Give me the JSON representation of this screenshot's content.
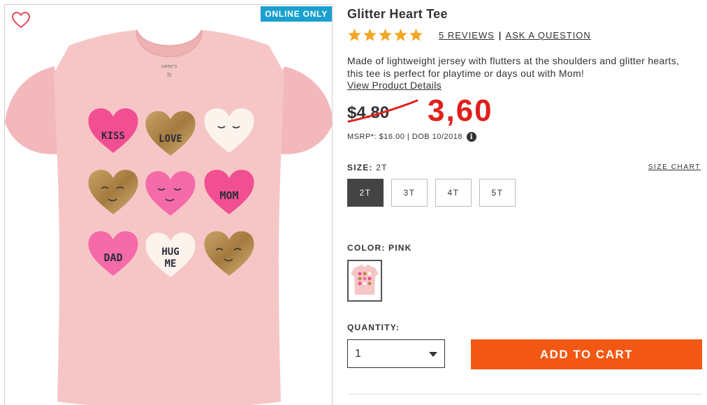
{
  "product": {
    "badge": "ONLINE ONLY",
    "title": "Glitter Heart Tee",
    "rating_stars": 5,
    "reviews_label": "5 REVIEWS",
    "separator": "|",
    "ask_label": "ASK A QUESTION",
    "description": "Made of lightweight jersey with flutters at the shoulders and glitter hearts, this tee is perfect for playtime or days out with Mom!",
    "details_link": "View Product Details",
    "old_price": "$4.80",
    "new_price": "3,60",
    "msrp": "MSRP*: $16.00 | DOB 10/2018",
    "info_icon": "i",
    "tag_brand": "carter's",
    "tag_size": "3t",
    "heart_words": [
      "KISS",
      "LOVE",
      "MOM",
      "DAD",
      "HUG",
      "ME"
    ]
  },
  "size": {
    "label": "SIZE:",
    "value": "2T",
    "chart_link": "SIZE CHART",
    "options": [
      "2T",
      "3T",
      "4T",
      "5T"
    ],
    "selected": "2T"
  },
  "color": {
    "label": "COLOR: PINK"
  },
  "quantity": {
    "label": "QUANTITY:",
    "value": "1"
  },
  "cart": {
    "button": "ADD TO CART"
  },
  "colors": {
    "badge": "#1aa0cf",
    "price_red": "#e0201b",
    "cta": "#f25813",
    "star": "#f5a623",
    "shirt": "#f6c6c6"
  },
  "icons": {
    "wishlist": "heart-outline-icon",
    "star": "star-icon",
    "info": "info-icon",
    "dropdown": "chevron-down-icon"
  }
}
